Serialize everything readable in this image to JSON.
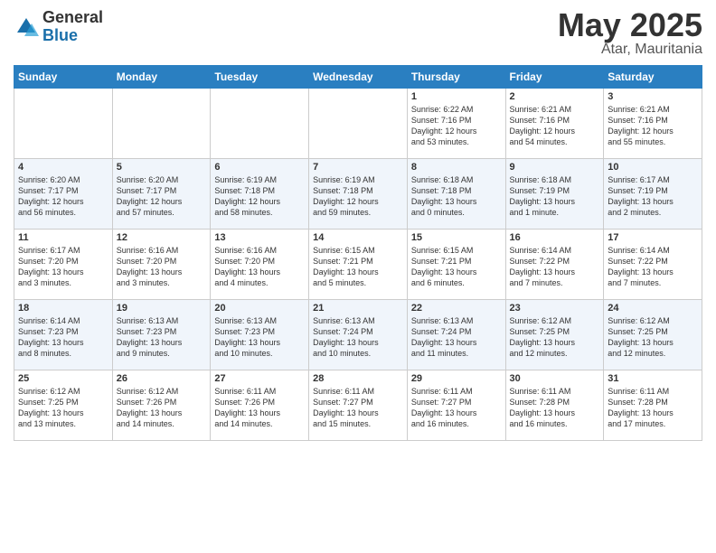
{
  "logo": {
    "general": "General",
    "blue": "Blue"
  },
  "title": {
    "month_year": "May 2025",
    "location": "Atar, Mauritania"
  },
  "weekdays": [
    "Sunday",
    "Monday",
    "Tuesday",
    "Wednesday",
    "Thursday",
    "Friday",
    "Saturday"
  ],
  "weeks": [
    [
      {
        "day": "",
        "info": ""
      },
      {
        "day": "",
        "info": ""
      },
      {
        "day": "",
        "info": ""
      },
      {
        "day": "",
        "info": ""
      },
      {
        "day": "1",
        "info": "Sunrise: 6:22 AM\nSunset: 7:16 PM\nDaylight: 12 hours\nand 53 minutes."
      },
      {
        "day": "2",
        "info": "Sunrise: 6:21 AM\nSunset: 7:16 PM\nDaylight: 12 hours\nand 54 minutes."
      },
      {
        "day": "3",
        "info": "Sunrise: 6:21 AM\nSunset: 7:16 PM\nDaylight: 12 hours\nand 55 minutes."
      }
    ],
    [
      {
        "day": "4",
        "info": "Sunrise: 6:20 AM\nSunset: 7:17 PM\nDaylight: 12 hours\nand 56 minutes."
      },
      {
        "day": "5",
        "info": "Sunrise: 6:20 AM\nSunset: 7:17 PM\nDaylight: 12 hours\nand 57 minutes."
      },
      {
        "day": "6",
        "info": "Sunrise: 6:19 AM\nSunset: 7:18 PM\nDaylight: 12 hours\nand 58 minutes."
      },
      {
        "day": "7",
        "info": "Sunrise: 6:19 AM\nSunset: 7:18 PM\nDaylight: 12 hours\nand 59 minutes."
      },
      {
        "day": "8",
        "info": "Sunrise: 6:18 AM\nSunset: 7:18 PM\nDaylight: 13 hours\nand 0 minutes."
      },
      {
        "day": "9",
        "info": "Sunrise: 6:18 AM\nSunset: 7:19 PM\nDaylight: 13 hours\nand 1 minute."
      },
      {
        "day": "10",
        "info": "Sunrise: 6:17 AM\nSunset: 7:19 PM\nDaylight: 13 hours\nand 2 minutes."
      }
    ],
    [
      {
        "day": "11",
        "info": "Sunrise: 6:17 AM\nSunset: 7:20 PM\nDaylight: 13 hours\nand 3 minutes."
      },
      {
        "day": "12",
        "info": "Sunrise: 6:16 AM\nSunset: 7:20 PM\nDaylight: 13 hours\nand 3 minutes."
      },
      {
        "day": "13",
        "info": "Sunrise: 6:16 AM\nSunset: 7:20 PM\nDaylight: 13 hours\nand 4 minutes."
      },
      {
        "day": "14",
        "info": "Sunrise: 6:15 AM\nSunset: 7:21 PM\nDaylight: 13 hours\nand 5 minutes."
      },
      {
        "day": "15",
        "info": "Sunrise: 6:15 AM\nSunset: 7:21 PM\nDaylight: 13 hours\nand 6 minutes."
      },
      {
        "day": "16",
        "info": "Sunrise: 6:14 AM\nSunset: 7:22 PM\nDaylight: 13 hours\nand 7 minutes."
      },
      {
        "day": "17",
        "info": "Sunrise: 6:14 AM\nSunset: 7:22 PM\nDaylight: 13 hours\nand 7 minutes."
      }
    ],
    [
      {
        "day": "18",
        "info": "Sunrise: 6:14 AM\nSunset: 7:23 PM\nDaylight: 13 hours\nand 8 minutes."
      },
      {
        "day": "19",
        "info": "Sunrise: 6:13 AM\nSunset: 7:23 PM\nDaylight: 13 hours\nand 9 minutes."
      },
      {
        "day": "20",
        "info": "Sunrise: 6:13 AM\nSunset: 7:23 PM\nDaylight: 13 hours\nand 10 minutes."
      },
      {
        "day": "21",
        "info": "Sunrise: 6:13 AM\nSunset: 7:24 PM\nDaylight: 13 hours\nand 10 minutes."
      },
      {
        "day": "22",
        "info": "Sunrise: 6:13 AM\nSunset: 7:24 PM\nDaylight: 13 hours\nand 11 minutes."
      },
      {
        "day": "23",
        "info": "Sunrise: 6:12 AM\nSunset: 7:25 PM\nDaylight: 13 hours\nand 12 minutes."
      },
      {
        "day": "24",
        "info": "Sunrise: 6:12 AM\nSunset: 7:25 PM\nDaylight: 13 hours\nand 12 minutes."
      }
    ],
    [
      {
        "day": "25",
        "info": "Sunrise: 6:12 AM\nSunset: 7:25 PM\nDaylight: 13 hours\nand 13 minutes."
      },
      {
        "day": "26",
        "info": "Sunrise: 6:12 AM\nSunset: 7:26 PM\nDaylight: 13 hours\nand 14 minutes."
      },
      {
        "day": "27",
        "info": "Sunrise: 6:11 AM\nSunset: 7:26 PM\nDaylight: 13 hours\nand 14 minutes."
      },
      {
        "day": "28",
        "info": "Sunrise: 6:11 AM\nSunset: 7:27 PM\nDaylight: 13 hours\nand 15 minutes."
      },
      {
        "day": "29",
        "info": "Sunrise: 6:11 AM\nSunset: 7:27 PM\nDaylight: 13 hours\nand 16 minutes."
      },
      {
        "day": "30",
        "info": "Sunrise: 6:11 AM\nSunset: 7:28 PM\nDaylight: 13 hours\nand 16 minutes."
      },
      {
        "day": "31",
        "info": "Sunrise: 6:11 AM\nSunset: 7:28 PM\nDaylight: 13 hours\nand 17 minutes."
      }
    ]
  ]
}
